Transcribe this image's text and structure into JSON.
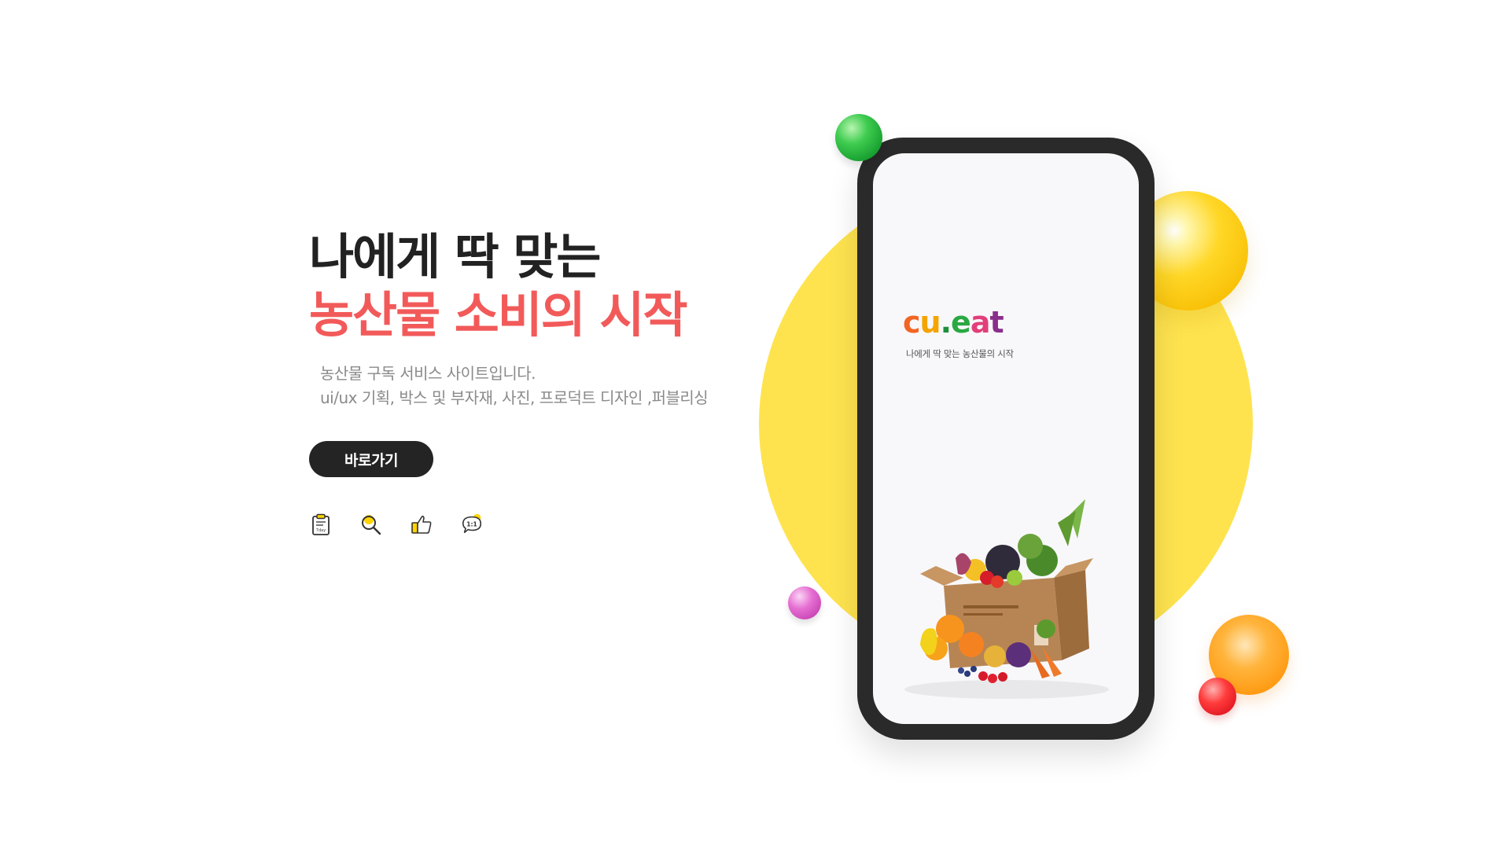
{
  "hero": {
    "headline_line1": "나에게 딱 맞는",
    "headline_line2": "농산물 소비의 시작",
    "description_line1": "농산물 구독 서비스 사이트입니다.",
    "description_line2": "ui/ux 기획, 박스 및 부자재, 사진, 프로덕트 디자인 ,퍼블리싱",
    "cta_label": "바로가기"
  },
  "feature_icons": [
    {
      "name": "clipboard-icon",
      "text": "7day"
    },
    {
      "name": "magnifier-icon"
    },
    {
      "name": "thumbs-up-icon"
    },
    {
      "name": "chat-bubble-icon",
      "text": "1:1"
    }
  ],
  "phone": {
    "logo_parts": [
      "c",
      "u",
      ".",
      "e",
      "a",
      "t"
    ],
    "tagline": "나에게 딱 맞는 농산물의 시작"
  },
  "colors": {
    "headline_dark": "#222222",
    "headline_accent": "#f25a5a",
    "button_bg": "#242424",
    "circle_yellow": "#fee34f",
    "phone_frame": "#2a2a2a"
  }
}
